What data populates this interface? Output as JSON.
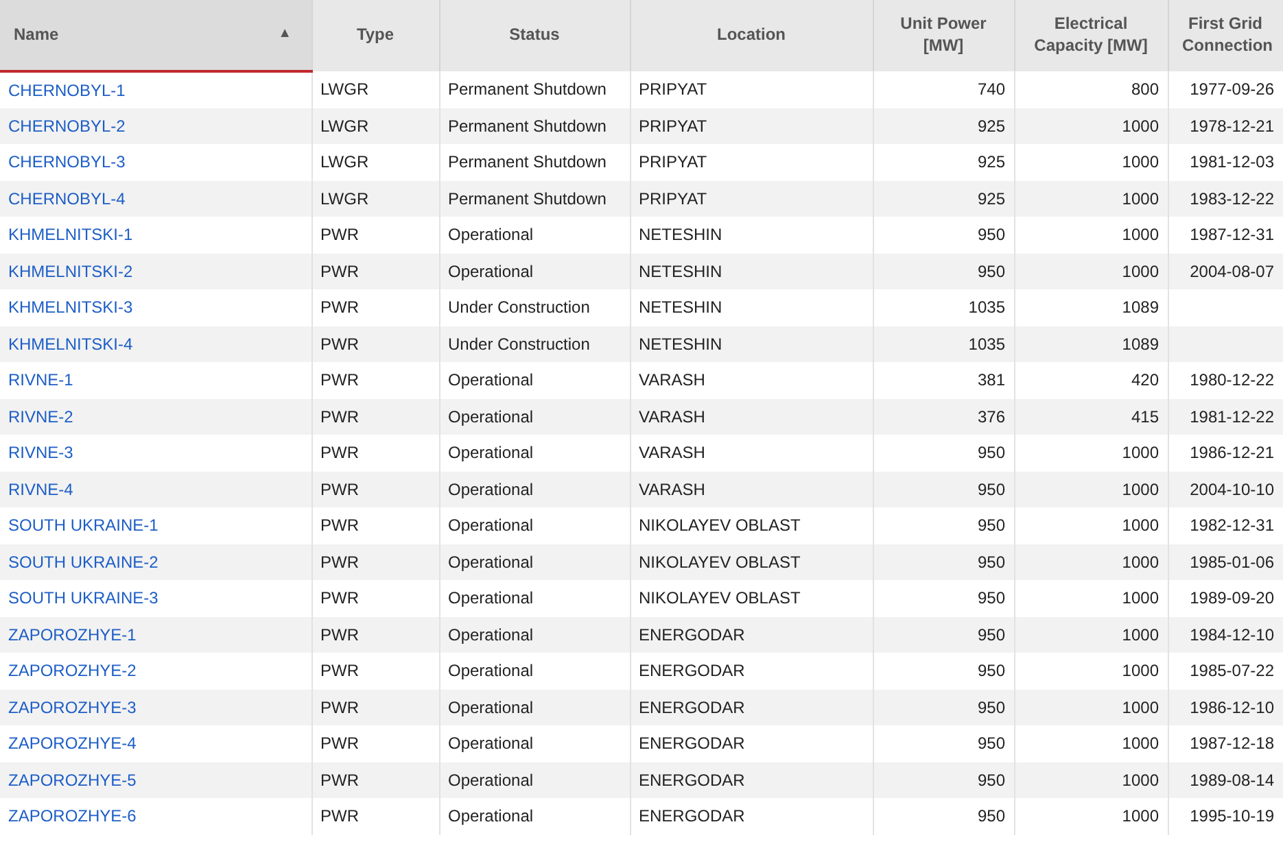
{
  "table": {
    "columns": [
      {
        "label": "Name",
        "sorted": true,
        "sort_icon": "▲"
      },
      {
        "label": "Type",
        "sorted": false
      },
      {
        "label": "Status",
        "sorted": false
      },
      {
        "label": "Location",
        "sorted": false
      },
      {
        "label": "Unit Power [MW]",
        "sorted": false
      },
      {
        "label": "Electrical Capacity [MW]",
        "sorted": false
      },
      {
        "label": "First Grid Connection",
        "sorted": false
      }
    ],
    "rows": [
      [
        "CHERNOBYL-1",
        "LWGR",
        "Permanent Shutdown",
        "PRIPYAT",
        "740",
        "800",
        "1977-09-26"
      ],
      [
        "CHERNOBYL-2",
        "LWGR",
        "Permanent Shutdown",
        "PRIPYAT",
        "925",
        "1000",
        "1978-12-21"
      ],
      [
        "CHERNOBYL-3",
        "LWGR",
        "Permanent Shutdown",
        "PRIPYAT",
        "925",
        "1000",
        "1981-12-03"
      ],
      [
        "CHERNOBYL-4",
        "LWGR",
        "Permanent Shutdown",
        "PRIPYAT",
        "925",
        "1000",
        "1983-12-22"
      ],
      [
        "KHMELNITSKI-1",
        "PWR",
        "Operational",
        "NETESHIN",
        "950",
        "1000",
        "1987-12-31"
      ],
      [
        "KHMELNITSKI-2",
        "PWR",
        "Operational",
        "NETESHIN",
        "950",
        "1000",
        "2004-08-07"
      ],
      [
        "KHMELNITSKI-3",
        "PWR",
        "Under Construction",
        "NETESHIN",
        "1035",
        "1089",
        ""
      ],
      [
        "KHMELNITSKI-4",
        "PWR",
        "Under Construction",
        "NETESHIN",
        "1035",
        "1089",
        ""
      ],
      [
        "RIVNE-1",
        "PWR",
        "Operational",
        "VARASH",
        "381",
        "420",
        "1980-12-22"
      ],
      [
        "RIVNE-2",
        "PWR",
        "Operational",
        "VARASH",
        "376",
        "415",
        "1981-12-22"
      ],
      [
        "RIVNE-3",
        "PWR",
        "Operational",
        "VARASH",
        "950",
        "1000",
        "1986-12-21"
      ],
      [
        "RIVNE-4",
        "PWR",
        "Operational",
        "VARASH",
        "950",
        "1000",
        "2004-10-10"
      ],
      [
        "SOUTH UKRAINE-1",
        "PWR",
        "Operational",
        "NIKOLAYEV OBLAST",
        "950",
        "1000",
        "1982-12-31"
      ],
      [
        "SOUTH UKRAINE-2",
        "PWR",
        "Operational",
        "NIKOLAYEV OBLAST",
        "950",
        "1000",
        "1985-01-06"
      ],
      [
        "SOUTH UKRAINE-3",
        "PWR",
        "Operational",
        "NIKOLAYEV OBLAST",
        "950",
        "1000",
        "1989-09-20"
      ],
      [
        "ZAPOROZHYE-1",
        "PWR",
        "Operational",
        "ENERGODAR",
        "950",
        "1000",
        "1984-12-10"
      ],
      [
        "ZAPOROZHYE-2",
        "PWR",
        "Operational",
        "ENERGODAR",
        "950",
        "1000",
        "1985-07-22"
      ],
      [
        "ZAPOROZHYE-3",
        "PWR",
        "Operational",
        "ENERGODAR",
        "950",
        "1000",
        "1986-12-10"
      ],
      [
        "ZAPOROZHYE-4",
        "PWR",
        "Operational",
        "ENERGODAR",
        "950",
        "1000",
        "1987-12-18"
      ],
      [
        "ZAPOROZHYE-5",
        "PWR",
        "Operational",
        "ENERGODAR",
        "950",
        "1000",
        "1989-08-14"
      ],
      [
        "ZAPOROZHYE-6",
        "PWR",
        "Operational",
        "ENERGODAR",
        "950",
        "1000",
        "1995-10-19"
      ]
    ]
  }
}
